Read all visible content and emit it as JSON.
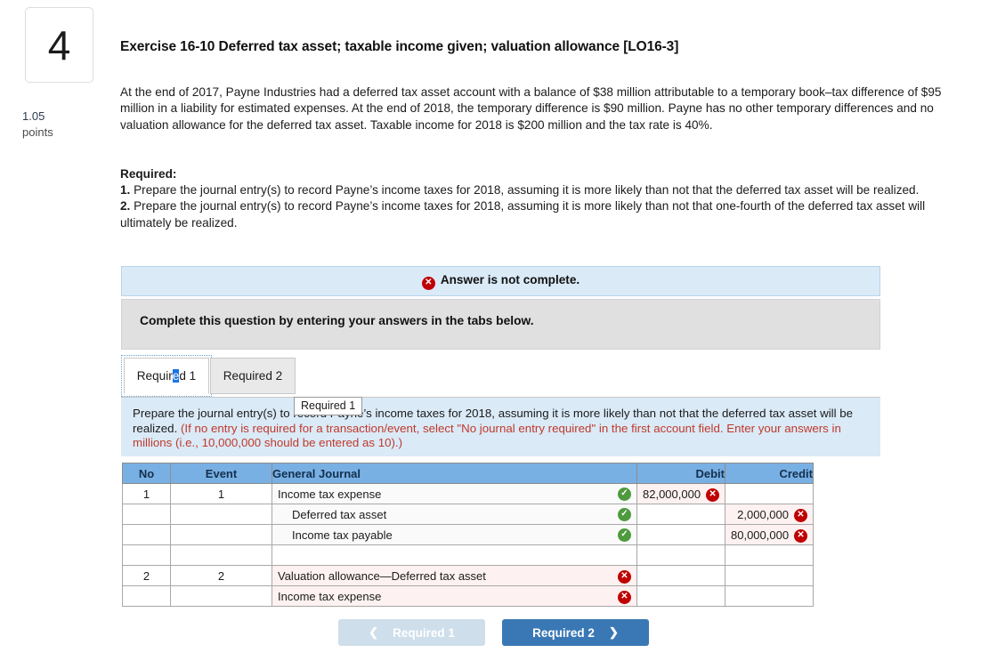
{
  "question": {
    "number": "4",
    "points_value": "1.05",
    "points_label": "points",
    "title": "Exercise 16-10 Deferred tax asset; taxable income given; valuation allowance [LO16-3]",
    "body": "At the end of 2017, Payne Industries had a deferred tax asset account with a balance of $38 million attributable to a temporary book–tax difference of $95 million in a liability for estimated expenses. At the end of 2018, the temporary difference is $90 million. Payne has no other temporary differences and no valuation allowance for the deferred tax asset. Taxable income for 2018 is $200 million and the tax rate is 40%.",
    "required_heading": "Required:",
    "requirements": [
      {
        "num": "1.",
        "text": " Prepare the journal entry(s) to record Payne’s income taxes for 2018, assuming it is more likely than not that the deferred tax asset will be realized."
      },
      {
        "num": "2.",
        "text": " Prepare the journal entry(s) to record Payne’s income taxes for 2018, assuming it is more likely than not that one-fourth of the deferred tax asset will ultimately be realized."
      }
    ]
  },
  "alert": {
    "icon": "x-circle-icon",
    "icon_glyph": "✕",
    "text": "Answer is not complete.",
    "background": "#daeaf7",
    "icon_color": "#c00000"
  },
  "instruction_bar": {
    "text": "Complete this question by entering your answers in the tabs below.",
    "background": "#e0e0e0"
  },
  "tabs": [
    {
      "label": "Required 1",
      "label_pre": "Requir",
      "label_sel": "e",
      "label_post": "d 1",
      "active": true
    },
    {
      "label": "Required 2",
      "active": false
    }
  ],
  "tooltip": {
    "text": "Required 1"
  },
  "task_panel": {
    "main": "Prepare the journal entry(s) to record Payne’s income taxes for 2018, assuming it is more likely than not that the deferred tax asset will be realized. ",
    "note": "(If no entry is required for a transaction/event, select \"No journal entry required\" in the first account field. Enter your answers in millions (i.e., 10,000,000 should be entered as 10).)",
    "background": "#daeaf7",
    "note_color": "#c0392b"
  },
  "journal_table": {
    "headers": [
      "No",
      "Event",
      "General Journal",
      "Debit",
      "Credit"
    ],
    "header_background": "#79b0e4",
    "rows": [
      {
        "no": "1",
        "event": "1",
        "account": "Income tax expense",
        "indent": false,
        "account_status": "correct",
        "account_status_glyph": "✓",
        "debit": "82,000,000",
        "debit_status": "incorrect",
        "debit_status_glyph": "✕",
        "credit": "",
        "credit_status": ""
      },
      {
        "no": "",
        "event": "",
        "account": "Deferred tax asset",
        "indent": true,
        "account_status": "correct",
        "account_status_glyph": "✓",
        "debit": "",
        "debit_status": "",
        "credit": "2,000,000",
        "credit_status": "incorrect",
        "credit_status_glyph": "✕"
      },
      {
        "no": "",
        "event": "",
        "account": "Income tax payable",
        "indent": true,
        "account_status": "correct",
        "account_status_glyph": "✓",
        "debit": "",
        "debit_status": "",
        "credit": "80,000,000",
        "credit_status": "incorrect",
        "credit_status_glyph": "✕"
      },
      {
        "no": "",
        "event": "",
        "account": "",
        "indent": false,
        "account_status": "",
        "debit": "",
        "debit_status": "",
        "credit": "",
        "credit_status": ""
      },
      {
        "no": "2",
        "event": "2",
        "account": "Valuation allowance—Deferred tax asset",
        "indent": false,
        "account_status": "incorrect",
        "account_status_glyph": "✕",
        "debit": "",
        "debit_status": "",
        "credit": "",
        "credit_status": ""
      },
      {
        "no": "",
        "event": "",
        "account": "Income tax expense",
        "indent": false,
        "account_status": "incorrect",
        "account_status_glyph": "✕",
        "debit": "",
        "debit_status": "",
        "credit": "",
        "credit_status": ""
      }
    ]
  },
  "nav": {
    "prev_label": "Required 1",
    "prev_icon": "chevron-left-icon",
    "prev_glyph": "❮",
    "prev_disabled": true,
    "prev_background": "#cedeeb",
    "next_label": "Required 2",
    "next_icon": "chevron-right-icon",
    "next_glyph": "❯",
    "next_background": "#3a78b5"
  }
}
